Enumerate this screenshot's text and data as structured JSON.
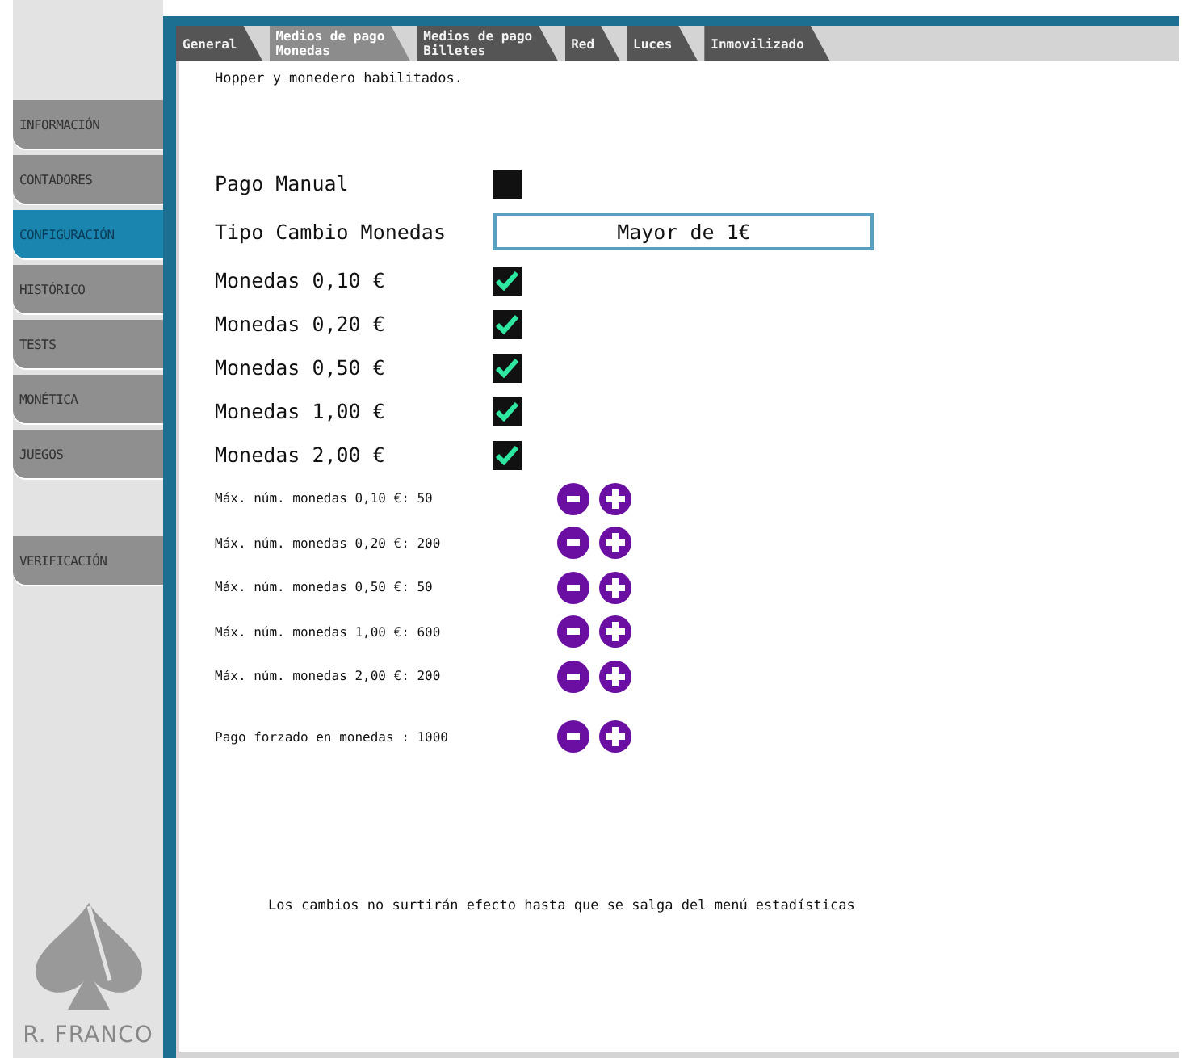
{
  "sidebar": {
    "items": [
      {
        "label": "INFORMACIÓN",
        "selected": false
      },
      {
        "label": "CONTADORES",
        "selected": false
      },
      {
        "label": "CONFIGURACIÓN",
        "selected": true
      },
      {
        "label": "HISTÓRICO",
        "selected": false
      },
      {
        "label": "TESTS",
        "selected": false
      },
      {
        "label": "MONÉTICA",
        "selected": false
      },
      {
        "label": "JUEGOS",
        "selected": false
      }
    ],
    "extra_items": [
      {
        "label": "VERIFICACIÓN",
        "selected": false
      }
    ],
    "logo_text": "R. FRANCO"
  },
  "tabs": [
    {
      "lines": [
        "General"
      ],
      "selected": false
    },
    {
      "lines": [
        "Medios de pago",
        "Monedas"
      ],
      "selected": true
    },
    {
      "lines": [
        "Medios de pago",
        "Billetes"
      ],
      "selected": false
    },
    {
      "lines": [
        "Red"
      ],
      "selected": false
    },
    {
      "lines": [
        "Luces"
      ],
      "selected": false
    },
    {
      "lines": [
        "Inmovilizado"
      ],
      "selected": false
    }
  ],
  "status": "Hopper y monedero habilitados.",
  "manual_payment": {
    "label": "Pago Manual",
    "checked": false
  },
  "change_type": {
    "label": "Tipo Cambio Monedas",
    "value": "Mayor de 1€"
  },
  "coins": [
    {
      "label": "Monedas 0,10 €",
      "checked": true
    },
    {
      "label": "Monedas 0,20 €",
      "checked": true
    },
    {
      "label": "Monedas 0,50 €",
      "checked": true
    },
    {
      "label": "Monedas 1,00 €",
      "checked": true
    },
    {
      "label": "Monedas 2,00 €",
      "checked": true
    }
  ],
  "limits": [
    {
      "label": "Máx. núm. monedas 0,10 €: 50"
    },
    {
      "label": "Máx. núm. monedas 0,20 €: 200"
    },
    {
      "label": "Máx. núm. monedas 0,50 €: 50"
    },
    {
      "label": "Máx. núm. monedas 1,00 €: 600"
    },
    {
      "label": "Máx. núm. monedas 2,00 €: 200"
    }
  ],
  "forced_payment": {
    "label": "Pago forzado en monedas : 1000"
  },
  "notice": "Los cambios no surtirán efecto hasta que se salga del menú estadísticas"
}
